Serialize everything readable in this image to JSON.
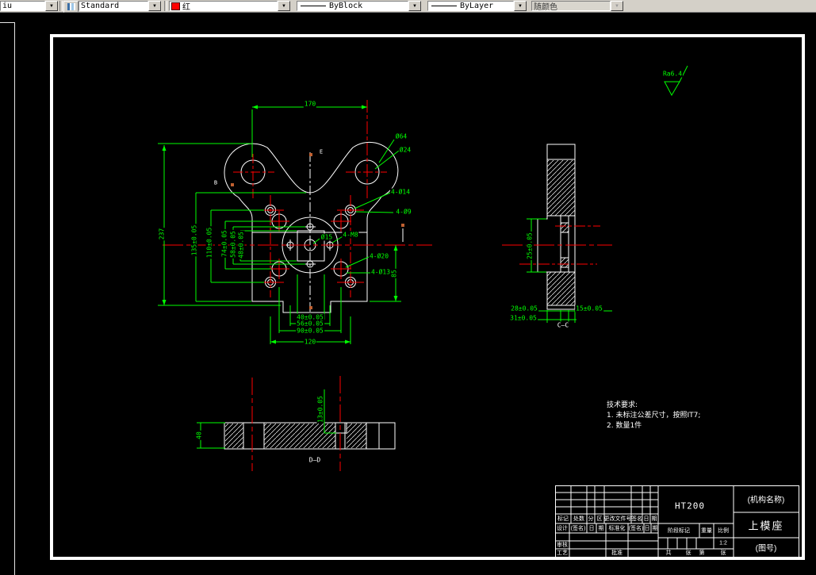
{
  "toolbar": {
    "layer_combo": "iu",
    "style_combo": "Standard",
    "color_combo": "红",
    "linetype_combo": "ByBlock",
    "lineweight_combo": "ByLayer",
    "plotstyle_combo": "随颜色"
  },
  "colors": {
    "dimension": "#00ff00",
    "centerline": "#ff0000",
    "geometry": "#ffffff",
    "grip": "#c06030",
    "toolbar_bg": "#d4d0c8"
  },
  "drawing": {
    "main": {
      "dim_width_top": "170",
      "dim_d64": "Ø64",
      "dim_d24": "Ø24",
      "dim_height": "237",
      "dim_135": "135±0.05",
      "dim_110": "110±0.05",
      "dim_74": "74±0.05",
      "dim_58": "58±0.05",
      "dim_48": "48±0.05",
      "leader_4d14": "4-Ø14",
      "leader_4d9": "4-Ø9",
      "leader_4d20": "4-Ø20",
      "leader_4d13": "4-Ø13",
      "leader_d15": "Ø15",
      "leader_4m8": "4-M8",
      "dim_40_bottom": "40±0.05",
      "dim_56_bottom": "56±0.05",
      "dim_90_bottom": "90±0.05",
      "dim_120_bottom": "120",
      "dim_85_right": "85",
      "mark_e": "E",
      "mark_b": "B"
    },
    "section_cc": {
      "dim_25": "25±0.05",
      "dim_28": "28±0.05",
      "dim_15": "15±0.05",
      "dim_31": "31±0.05",
      "label": "C—C"
    },
    "section_dd": {
      "dim_40": "40",
      "dim_13": "13±0.05",
      "label": "D—D"
    },
    "roughness": "Ra6.4",
    "tech": {
      "line1": "技术要求:",
      "line2": "1. 未标注公差尺寸，按照IT7;",
      "line3": "2. 数量1件"
    }
  },
  "titleblock": {
    "material": "HT200",
    "org_name": "(机构名称)",
    "part_name": "上模座",
    "drawing_no": "(图号)",
    "scale_value": "1:2",
    "stage_label": "阶段标记",
    "weight_label": "重量",
    "scale_label": "比例",
    "review": "审核",
    "process": "工艺",
    "approve": "批准",
    "row1": {
      "c1": "标记",
      "c2": "处数",
      "c3": "分",
      "c4": "区",
      "c5": "更改文件号",
      "c6": "签名",
      "c7": "日",
      "c8": "期"
    },
    "row2": {
      "c1": "设计",
      "c2": "(签名)",
      "c3": "日",
      "c4": "期",
      "c5": "标准化",
      "c6": "(签名)",
      "c7": "日",
      "c8": "期"
    },
    "sheet": {
      "c1": "共",
      "c2": "张",
      "c3": "第",
      "c4": "张"
    }
  }
}
